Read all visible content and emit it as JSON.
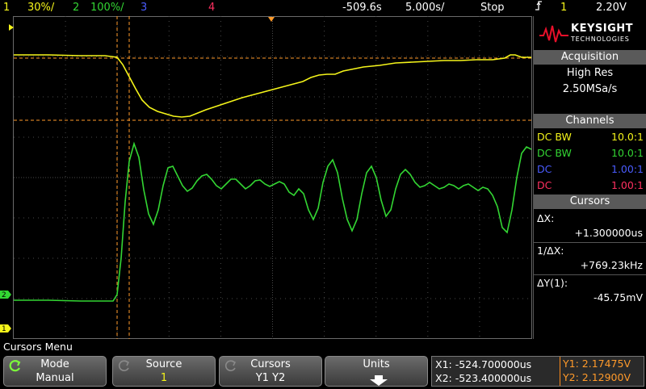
{
  "topbar": {
    "ch1_num": "1",
    "ch1_scale": "30%/",
    "ch2_num": "2",
    "ch2_scale": "100%/",
    "ch3_num": "3",
    "ch4_num": "4",
    "time_offset": "-509.6s",
    "time_scale": "5.000s/",
    "run_state": "Stop",
    "trigger_icon": "trigger-edge-icon",
    "trig_ch": "1",
    "trig_level": "2.20V"
  },
  "brand": {
    "name": "KEYSIGHT",
    "sub": "TECHNOLOGIES",
    "logo_icon": "keysight-wave-logo"
  },
  "acquisition": {
    "header": "Acquisition",
    "mode": "High Res",
    "rate": "2.50MSa/s"
  },
  "channels": {
    "header": "Channels",
    "rows": [
      {
        "coupling": "DC BW",
        "probe": "10.0:1",
        "color": "#f5f51a"
      },
      {
        "coupling": "DC BW",
        "probe": "10.0:1",
        "color": "#33d633"
      },
      {
        "coupling": "DC",
        "probe": "1.00:1",
        "color": "#4a5cff"
      },
      {
        "coupling": "DC",
        "probe": "1.00:1",
        "color": "#ff3060"
      }
    ]
  },
  "cursors": {
    "header": "Cursors",
    "dx_label": "ΔX:",
    "dx_value": "+1.300000us",
    "inv_label": "1/ΔX:",
    "inv_value": "+769.23kHz",
    "dy_label": "ΔY(1):",
    "dy_value": "-45.75mV"
  },
  "menu": {
    "title": "Cursors Menu",
    "keys": [
      {
        "title": "Mode",
        "value": "Manual",
        "icon": "rotate-knob-icon"
      },
      {
        "title": "Source",
        "value": "1",
        "icon": "rotate-knob-icon"
      },
      {
        "title": "Cursors",
        "value": "Y1 Y2",
        "icon": "rotate-knob-icon"
      },
      {
        "title": "Units",
        "value": "",
        "icon": "arrow-down-icon"
      }
    ]
  },
  "readout": {
    "x1": "X1: -524.700000us",
    "x2": "X2: -523.400000us",
    "y1": "Y1: 2.17475V",
    "y2": "Y2: 2.12900V"
  },
  "markers": {
    "ch2_ground": "2",
    "ch1_ground": "1"
  },
  "colors": {
    "ch1": "#f5f51a",
    "ch2": "#33d633",
    "ch3": "#4a5cff",
    "ch4": "#ff3060",
    "cursor": "#ff9a2a"
  }
}
